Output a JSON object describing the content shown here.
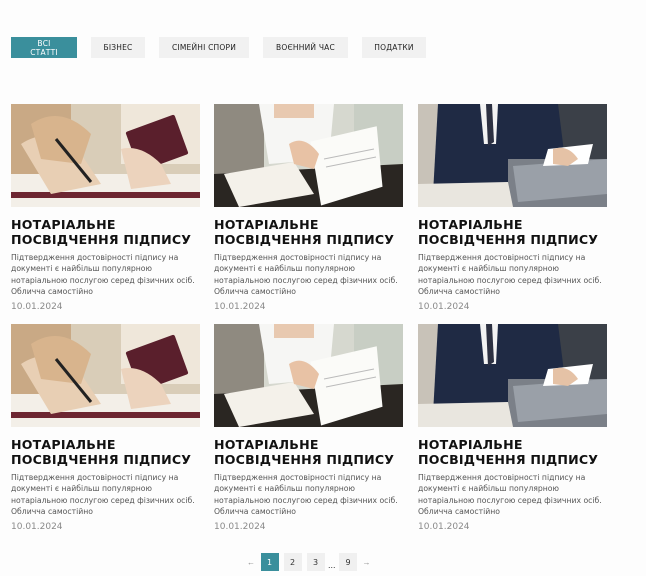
{
  "filters": [
    {
      "label": "ВСІ СТАТТІ",
      "active": true
    },
    {
      "label": "БІЗНЕС",
      "active": false
    },
    {
      "label": "СІМЕЙНІ СПОРИ",
      "active": false
    },
    {
      "label": "ВОЄННИЙ ЧАС",
      "active": false
    },
    {
      "label": "ПОДАТКИ",
      "active": false
    }
  ],
  "articles": [
    {
      "title": "НОТАРІАЛЬНЕ ПОСВІДЧЕННЯ ПІДПИСУ",
      "excerpt": "Підтвердження достовірності підпису на документі є найбільш популярною нотаріальною послугою серед фізичних осіб. Обличча самостійно",
      "date": "10.01.2024",
      "image": "passport"
    },
    {
      "title": "НОТАРІАЛЬНЕ ПОСВІДЧЕННЯ ПІДПИСУ",
      "excerpt": "Підтвердження достовірності підпису на документі є найбільш популярною нотаріальною послугою серед фізичних осіб. Обличча самостійно",
      "date": "10.01.2024",
      "image": "documents"
    },
    {
      "title": "НОТАРІАЛЬНЕ ПОСВІДЧЕННЯ ПІДПИСУ",
      "excerpt": "Підтвердження достовірності підпису на документі є найбільш популярною нотаріальною послугою серед фізичних осіб. Обличча самостійно",
      "date": "10.01.2024",
      "image": "laptop"
    },
    {
      "title": "НОТАРІАЛЬНЕ ПОСВІДЧЕННЯ ПІДПИСУ",
      "excerpt": "Підтвердження достовірності підпису на документі є найбільш популярною нотаріальною послугою серед фізичних осіб. Обличча самостійно",
      "date": "10.01.2024",
      "image": "passport"
    },
    {
      "title": "НОТАРІАЛЬНЕ ПОСВІДЧЕННЯ ПІДПИСУ",
      "excerpt": "Підтвердження достовірності підпису на документі є найбільш популярною нотаріальною послугою серед фізичних осіб. Обличча самостійно",
      "date": "10.01.2024",
      "image": "documents"
    },
    {
      "title": "НОТАРІАЛЬНЕ ПОСВІДЧЕННЯ ПІДПИСУ",
      "excerpt": "Підтвердження достовірності підпису на документі є найбільш популярною нотаріальною послугою серед фізичних осіб. Обличча самостійно",
      "date": "10.01.2024",
      "image": "laptop"
    }
  ],
  "pagination": {
    "prev_icon": "arrow-left-icon",
    "next_icon": "arrow-right-icon",
    "pages": [
      "1",
      "2",
      "3"
    ],
    "current": "1",
    "ellipsis": "...",
    "last": "9"
  },
  "colors": {
    "accent": "#3a8f9c"
  }
}
